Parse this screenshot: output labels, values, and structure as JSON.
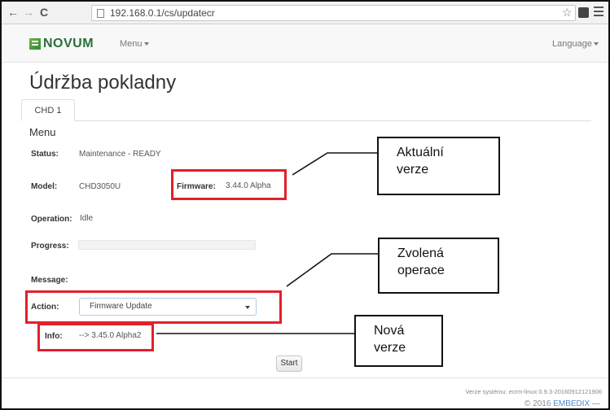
{
  "browser": {
    "back": "←",
    "forward": "→",
    "reload": "C",
    "url": "192.168.0.1/cs/updatecr",
    "star": "☆"
  },
  "navbar": {
    "brand": "NOVUM",
    "menu_label": "Menu",
    "language_label": "Language"
  },
  "page": {
    "title": "Údržba pokladny",
    "tab": "CHD 1",
    "section": "Menu"
  },
  "fields": {
    "status_label": "Status:",
    "status_value": "Maintenance - READY",
    "model_label": "Model:",
    "model_value": "CHD3050U",
    "firmware_label": "Firmware:",
    "firmware_value": "3.44.0 Alpha",
    "operation_label": "Operation:",
    "operation_value": "Idle",
    "progress_label": "Progress:",
    "progress_value": 0,
    "message_label": "Message:",
    "action_label": "Action:",
    "action_selected": "Firmware Update",
    "info_label": "Info:",
    "info_value": "--> 3.45.0 Alpha2",
    "start_label": "Start"
  },
  "footer": {
    "system_version": "Verze systému: ecrm-linux 0.9.3-20160912121906",
    "copyright_prefix": "© 2016",
    "copyright_brand": "EMBEDIX",
    "copyright_suffix": "—"
  },
  "callouts": {
    "current_version": [
      "Aktuální",
      "verze"
    ],
    "selected_operation": [
      "Zvolená",
      "operace"
    ],
    "new_version": [
      "Nová",
      "verze"
    ]
  },
  "colors": {
    "highlight": "#e3202a",
    "brand_green": "#2a6f3a",
    "link_blue": "#4a8ac8"
  },
  "icons": {
    "back": "arrow-left-icon",
    "forward": "arrow-right-icon",
    "reload": "reload-icon",
    "page": "page-icon",
    "star": "star-icon",
    "extension": "extension-icon",
    "menu": "hamburger-menu-icon",
    "caret": "caret-down-icon"
  }
}
